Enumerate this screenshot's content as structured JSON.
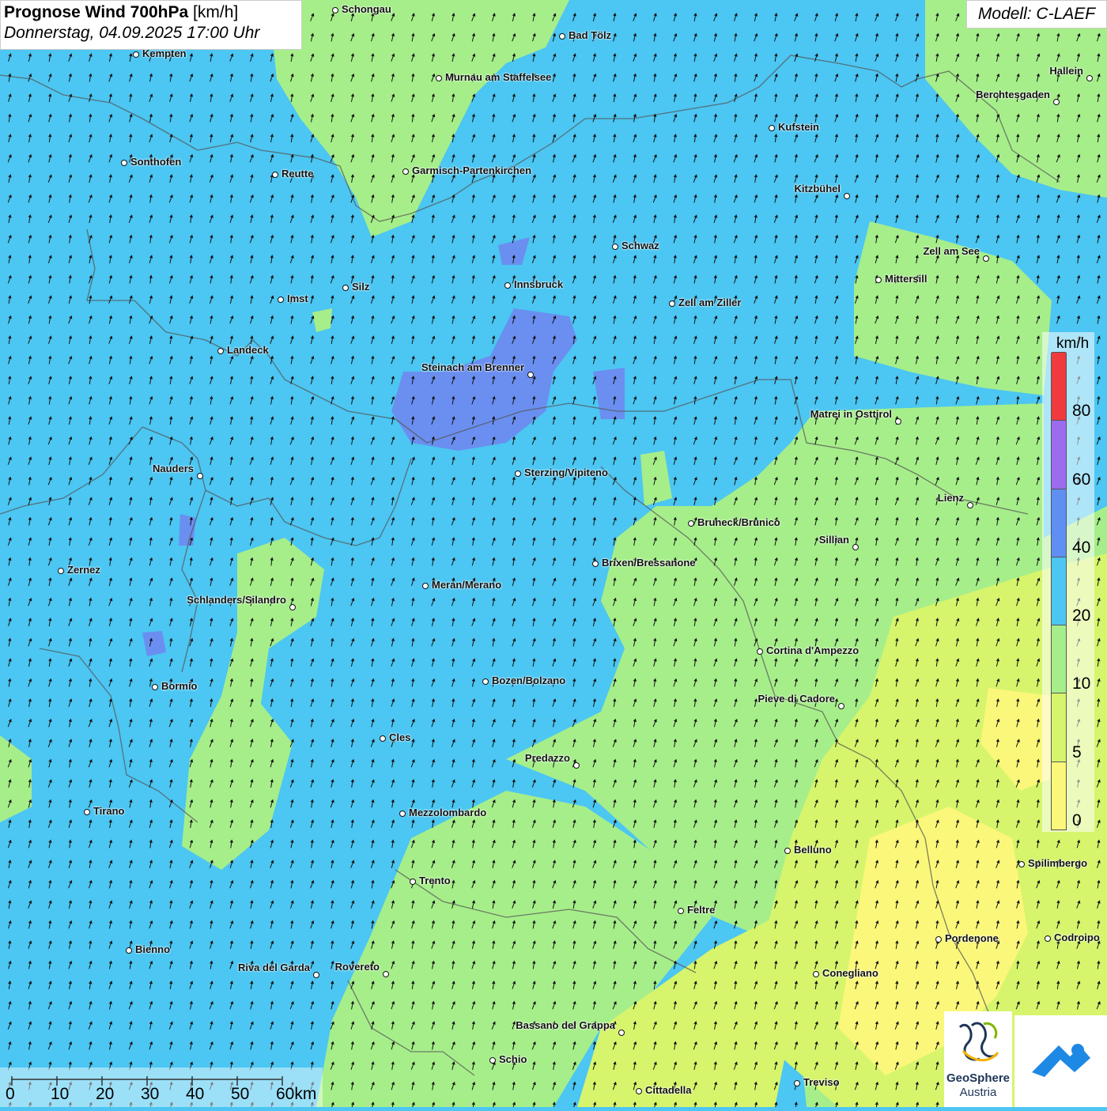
{
  "header": {
    "title_bold": "Prognose Wind 700hPa",
    "title_unit": " [km/h]",
    "subtitle": "Donnerstag, 04.09.2025 17:00 Uhr",
    "model": "Modell: C-LAEF"
  },
  "legend": {
    "unit": "km/h",
    "ticks": [
      "0",
      "5",
      "10",
      "20",
      "40",
      "60",
      "80"
    ],
    "colors": [
      "#fbf77a",
      "#d6f56c",
      "#a6ee8a",
      "#4cc6f2",
      "#5f8ff2",
      "#9b6cef",
      "#f03a3e"
    ]
  },
  "scale_bar": {
    "labels": [
      "0",
      "10",
      "20",
      "30",
      "40",
      "50",
      "60km"
    ]
  },
  "logos": {
    "geosphere_line1": "GeoSphere",
    "geosphere_line2": "Austria"
  },
  "wind_direction": "south-southwest to north-northeast",
  "cities": [
    {
      "name": "Schongau"
    },
    {
      "name": "Bad Tölz"
    },
    {
      "name": "Kempten"
    },
    {
      "name": "Murnau am Staffelsee"
    },
    {
      "name": "Hallein"
    },
    {
      "name": "Berchtesgaden"
    },
    {
      "name": "Kufstein"
    },
    {
      "name": "Sonthofen"
    },
    {
      "name": "Reutte"
    },
    {
      "name": "Garmisch-Partenkirchen"
    },
    {
      "name": "Kitzbühel"
    },
    {
      "name": "Schwaz"
    },
    {
      "name": "Zell am See"
    },
    {
      "name": "Mittersill"
    },
    {
      "name": "Innsbruck"
    },
    {
      "name": "Silz"
    },
    {
      "name": "Imst"
    },
    {
      "name": "Zell am Ziller"
    },
    {
      "name": "Landeck"
    },
    {
      "name": "Steinach am Brenner"
    },
    {
      "name": "Matrei in Osttirol"
    },
    {
      "name": "Nauders"
    },
    {
      "name": "Sterzing/Vipiteno"
    },
    {
      "name": "Lienz"
    },
    {
      "name": "Bruneck/Brunico"
    },
    {
      "name": "Sillian"
    },
    {
      "name": "Brixen/Bressanone"
    },
    {
      "name": "Zernez"
    },
    {
      "name": "Meran/Merano"
    },
    {
      "name": "Schlanders/Silandro"
    },
    {
      "name": "Cortina d'Ampezzo"
    },
    {
      "name": "Bozen/Bolzano"
    },
    {
      "name": "Bormio"
    },
    {
      "name": "Pieve di Cadore"
    },
    {
      "name": "Cles"
    },
    {
      "name": "Predazzo"
    },
    {
      "name": "Tirano"
    },
    {
      "name": "Mezzolombardo"
    },
    {
      "name": "Belluno"
    },
    {
      "name": "Spilimbergo"
    },
    {
      "name": "Trento"
    },
    {
      "name": "Feltre"
    },
    {
      "name": "Pordenone"
    },
    {
      "name": "Codroipo"
    },
    {
      "name": "Bienno"
    },
    {
      "name": "Riva del Garda"
    },
    {
      "name": "Rovereto"
    },
    {
      "name": "Conegliano"
    },
    {
      "name": "Bassano del Grappa"
    },
    {
      "name": "Schio"
    },
    {
      "name": "Treviso"
    },
    {
      "name": "Cittadella"
    }
  ]
}
